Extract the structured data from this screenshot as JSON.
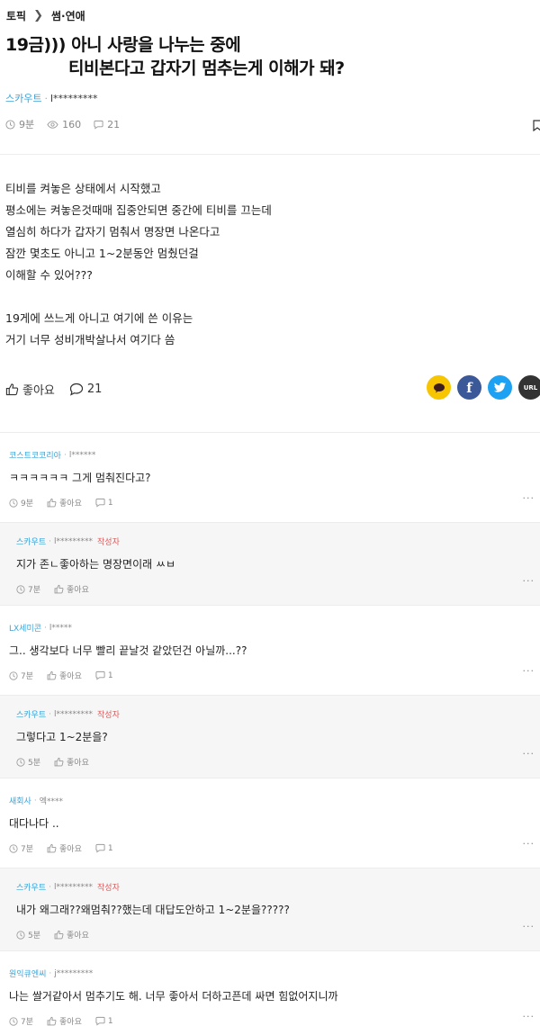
{
  "breadcrumb": {
    "root": "토픽",
    "current": "썸·연애"
  },
  "post": {
    "title_line1": "19금))) 아니 사랑을 나누는 중에",
    "title_line2": "티비본다고 갑자기 멈추는게 이해가 돼?",
    "author_nick": "스카우트",
    "author_id": "l*********",
    "time": "9분",
    "views": "160",
    "comment_count": "21",
    "body": [
      "티비를 켜놓은 상태에서 시작했고",
      "평소에는 켜놓은것때매 집중안되면 중간에 티비를 끄는데",
      "열심히 하다가 갑자기 멈춰서 명장면 나온다고",
      "잠깐 몇초도 아니고 1~2분동안 멈췄던걸",
      "이해할 수 있어???",
      "",
      "19게에 쓰느게 아니고 여기에 쓴 이유는",
      "거기 너무 성비개박살나서 여기다 씀"
    ],
    "like_label": "좋아요",
    "comments_label": "21"
  },
  "share": {
    "url_label": "URL"
  },
  "colors": {
    "accent": "#3ba3d8",
    "writer_badge": "#e25a5a",
    "kakao": "#f7c600",
    "facebook": "#3b5998",
    "twitter": "#1da1f2"
  },
  "comments": [
    {
      "nick": "코스트코코리아",
      "id": "l******",
      "writer": "",
      "text": "ㅋㅋㅋㅋㅋㅋ 그게 멈춰진다고?",
      "time": "9분",
      "like": "좋아요",
      "replies": "1",
      "reply": false
    },
    {
      "nick": "스카우트",
      "id": "l*********",
      "writer": "작성자",
      "text": "지가 존ㄴ좋아하는 명장면이래 ㅆㅂ",
      "time": "7분",
      "like": "좋아요",
      "replies": "",
      "reply": true
    },
    {
      "nick": "LX세미콘",
      "id": "l*****",
      "writer": "",
      "text": "그.. 생각보다 너무 빨리 끝날것 같았던건 아닐까...??",
      "time": "7분",
      "like": "좋아요",
      "replies": "1",
      "reply": false
    },
    {
      "nick": "스카우트",
      "id": "l*********",
      "writer": "작성자",
      "text": "그렇다고 1~2분을?",
      "time": "5분",
      "like": "좋아요",
      "replies": "",
      "reply": true
    },
    {
      "nick": "새회사",
      "id": "엑****",
      "writer": "",
      "text": "대다나다 ..",
      "time": "7분",
      "like": "좋아요",
      "replies": "1",
      "reply": false
    },
    {
      "nick": "스카우트",
      "id": "l*********",
      "writer": "작성자",
      "text": "내가 왜그래??왜멈춰??했는데 대답도안하고 1~2분을?????",
      "time": "5분",
      "like": "좋아요",
      "replies": "",
      "reply": true
    },
    {
      "nick": "원익큐엔씨",
      "id": "j*********",
      "writer": "",
      "text": "나는 쌀거같아서 멈추기도 해. 너무 좋아서 더하고픈데 싸면 힘없어지니까",
      "time": "7분",
      "like": "좋아요",
      "replies": "1",
      "reply": false
    }
  ]
}
